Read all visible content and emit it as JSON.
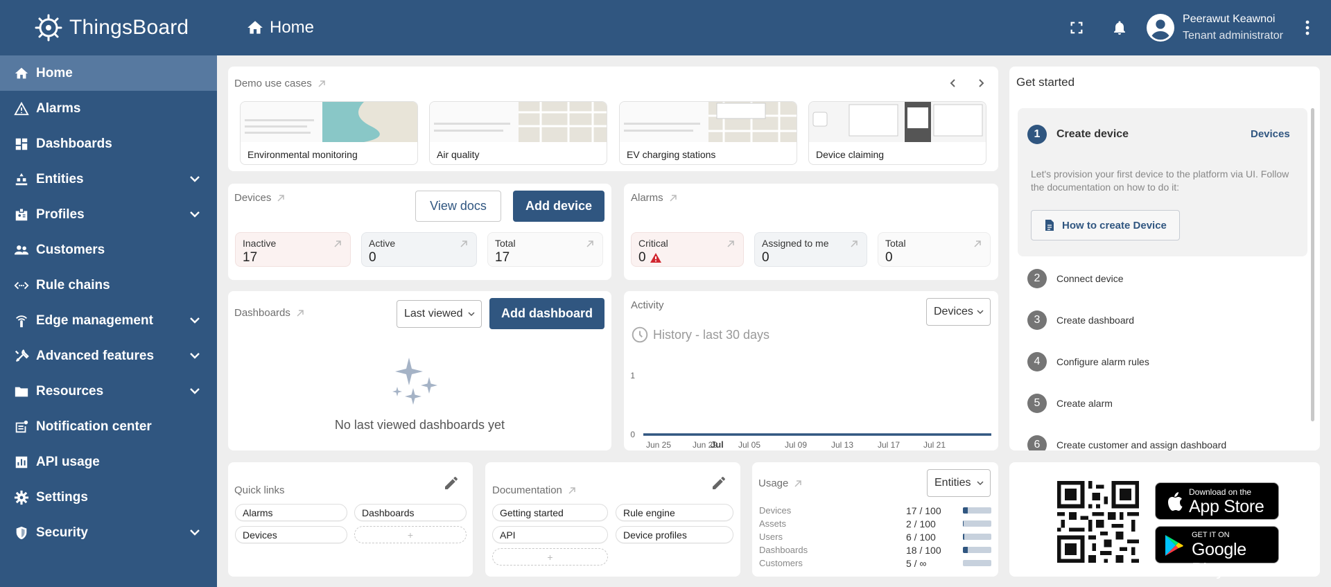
{
  "app": {
    "name": "ThingsBoard"
  },
  "header": {
    "page_title": "Home",
    "user_name": "Peerawut Keawnoi",
    "user_role": "Tenant administrator"
  },
  "sidebar": {
    "items": [
      {
        "label": "Home",
        "icon": "home-icon",
        "active": true,
        "expandable": false
      },
      {
        "label": "Alarms",
        "icon": "warning-icon",
        "active": false,
        "expandable": false
      },
      {
        "label": "Dashboards",
        "icon": "dashboard-icon",
        "active": false,
        "expandable": false
      },
      {
        "label": "Entities",
        "icon": "entities-icon",
        "active": false,
        "expandable": true
      },
      {
        "label": "Profiles",
        "icon": "badge-icon",
        "active": false,
        "expandable": true
      },
      {
        "label": "Customers",
        "icon": "people-icon",
        "active": false,
        "expandable": false
      },
      {
        "label": "Rule chains",
        "icon": "code-arrows-icon",
        "active": false,
        "expandable": false
      },
      {
        "label": "Edge management",
        "icon": "router-icon",
        "active": false,
        "expandable": true
      },
      {
        "label": "Advanced features",
        "icon": "tools-icon",
        "active": false,
        "expandable": true
      },
      {
        "label": "Resources",
        "icon": "folder-icon",
        "active": false,
        "expandable": true
      },
      {
        "label": "Notification center",
        "icon": "notification-icon",
        "active": false,
        "expandable": false
      },
      {
        "label": "API usage",
        "icon": "bar-chart-icon",
        "active": false,
        "expandable": false
      },
      {
        "label": "Settings",
        "icon": "gear-icon",
        "active": false,
        "expandable": false
      },
      {
        "label": "Security",
        "icon": "shield-icon",
        "active": false,
        "expandable": true
      }
    ]
  },
  "demo": {
    "title": "Demo use cases",
    "items": [
      "Environmental monitoring",
      "Air quality",
      "EV charging stations",
      "Device claiming"
    ]
  },
  "devices": {
    "title": "Devices",
    "view_docs": "View docs",
    "add": "Add device",
    "stats": [
      {
        "label": "Inactive",
        "value": "17"
      },
      {
        "label": "Active",
        "value": "0"
      },
      {
        "label": "Total",
        "value": "17"
      }
    ]
  },
  "alarms": {
    "title": "Alarms",
    "stats": [
      {
        "label": "Critical",
        "value": "0"
      },
      {
        "label": "Assigned to me",
        "value": "0"
      },
      {
        "label": "Total",
        "value": "0"
      }
    ]
  },
  "dashboards": {
    "title": "Dashboards",
    "select": "Last viewed",
    "add": "Add dashboard",
    "empty": "No last viewed dashboards yet"
  },
  "activity": {
    "title": "Activity",
    "select": "Devices",
    "history": "History - last 30 days"
  },
  "chart_data": {
    "type": "line",
    "x": [
      "Jun 25",
      "Jun 29",
      "Jul",
      "Jul 05",
      "Jul 09",
      "Jul 13",
      "Jul 17",
      "Jul 21"
    ],
    "y_ticks": [
      "1",
      "0"
    ],
    "series": [
      {
        "values": [
          0,
          0,
          0,
          0,
          0,
          0,
          0,
          0
        ]
      }
    ],
    "ylim": [
      0,
      1
    ],
    "grid": false,
    "color": "#305680"
  },
  "get_started": {
    "title": "Get started",
    "steps": [
      "Create device",
      "Connect device",
      "Create dashboard",
      "Configure alarm rules",
      "Create alarm",
      "Create customer and assign dashboard"
    ],
    "step_nums": [
      "1",
      "2",
      "3",
      "4",
      "5",
      "6"
    ],
    "devices_link": "Devices",
    "description": "Let's provision your first device to the platform via UI. Follow the documentation on how to do it:",
    "how_to": "How to create Device"
  },
  "quick_links": {
    "title": "Quick links",
    "items": [
      "Alarms",
      "Dashboards",
      "Devices"
    ]
  },
  "documentation": {
    "title": "Documentation",
    "items": [
      "Getting started",
      "Rule engine",
      "API",
      "Device profiles"
    ]
  },
  "usage": {
    "title": "Usage",
    "select": "Entities",
    "rows": [
      {
        "label": "Devices",
        "value": "17 / 100",
        "fraction": 0.17
      },
      {
        "label": "Assets",
        "value": "2 / 100",
        "fraction": 0.02
      },
      {
        "label": "Users",
        "value": "6 / 100",
        "fraction": 0.06
      },
      {
        "label": "Dashboards",
        "value": "18 / 100",
        "fraction": 0.18
      },
      {
        "label": "Customers",
        "value": "5 / ∞",
        "fraction": 0.0
      }
    ]
  },
  "mobile": {
    "app_store_small": "Download on the",
    "app_store_big": "App Store",
    "google_small": "GET IT ON",
    "google_big": "Google Play"
  },
  "colors": {
    "primary": "#305680",
    "nav_active": "#5779a0",
    "background": "#eeeeee",
    "critical": "#d12730"
  }
}
